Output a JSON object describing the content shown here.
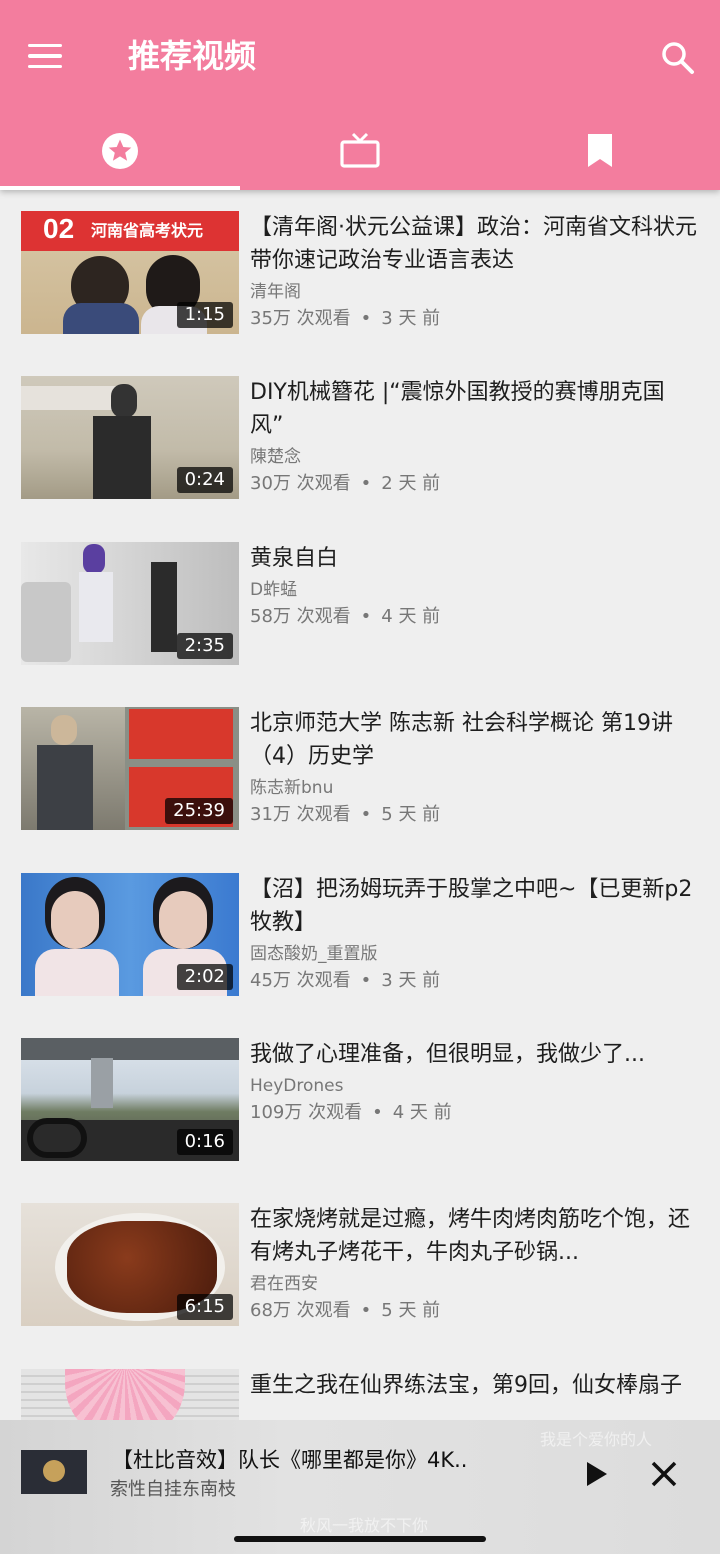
{
  "app": {
    "title": "推荐视频"
  },
  "icons": {
    "menu": "menu-icon",
    "search": "search-icon",
    "tab_recommended": "star-circle-icon",
    "tab_tv": "tv-icon",
    "tab_saved": "bookmark-icon",
    "play": "play-icon",
    "close": "close-icon"
  },
  "colors": {
    "appbar": "#f37d9e",
    "background": "#efefef"
  },
  "videos": [
    {
      "title": "【清年阁·状元公益课】政治：河南省文科状元带你速记政治专业语言表达",
      "channel": "清年阁",
      "views": "35万 次观看",
      "age": "3 天 前",
      "duration": "1:15",
      "thumb_text": "河南省高考状元",
      "thumb_num": "02"
    },
    {
      "title": "DIY机械簪花 |“震惊外国教授的赛博朋克国风”",
      "channel": "陳楚念",
      "views": "30万 次观看",
      "age": "2 天 前",
      "duration": "0:24"
    },
    {
      "title": "黄泉自白",
      "channel": "D蚱蜢",
      "views": "58万 次观看",
      "age": "4 天 前",
      "duration": "2:35"
    },
    {
      "title": "北京师范大学 陈志新 社会科学概论 第19讲 （4）历史学",
      "channel": "陈志新bnu",
      "views": "31万 次观看",
      "age": "5 天 前",
      "duration": "25:39"
    },
    {
      "title": "【沼】把汤姆玩弄于股掌之中吧~【已更新p2牧教】",
      "channel": "固态酸奶_重置版",
      "views": "45万 次观看",
      "age": "3 天 前",
      "duration": "2:02"
    },
    {
      "title": "我做了心理准备，但很明显，我做少了...",
      "channel": "HeyDrones",
      "views": "109万 次观看",
      "age": "4 天 前",
      "duration": "0:16"
    },
    {
      "title": "在家烧烤就是过瘾，烤牛肉烤肉筋吃个饱，还有烤丸子烤花干，牛肉丸子砂锅...",
      "channel": "君在西安",
      "views": "68万 次观看",
      "age": "5 天 前",
      "duration": "6:15"
    },
    {
      "title": "重生之我在仙界练法宝，第9回，仙女棒扇子",
      "channel": "",
      "views": "",
      "age": "",
      "duration": ""
    }
  ],
  "mini_player": {
    "title": "【杜比音效】队长《哪里都是你》4K..",
    "subtitle": "索性自挂东南枝",
    "bg_lyric_1": "我是个爱你的人",
    "bg_lyric_2": "秋风一我放不下你"
  }
}
